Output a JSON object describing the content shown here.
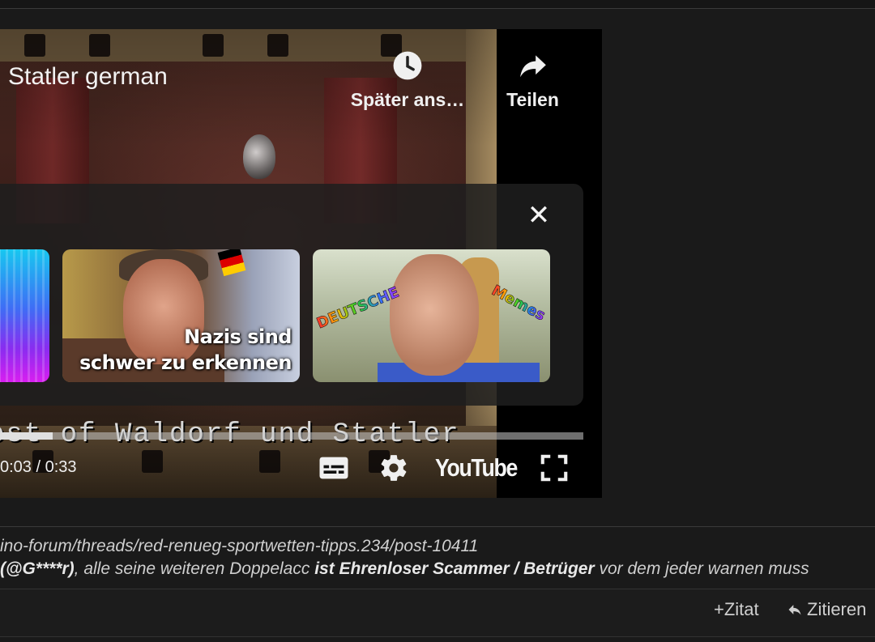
{
  "video": {
    "title": "Statler german",
    "watch_later_label": "Später ans…",
    "share_label": "Teilen",
    "close_symbol": "✕",
    "related": [
      {
        "caption": ""
      },
      {
        "caption_line1": "Nazis sind",
        "caption_line2": "schwer zu erkennen"
      },
      {
        "word_left": "DEUTSCHE",
        "word_right": "Memes"
      }
    ],
    "subtitle_overlay": "est of Waldorf und Statler",
    "progress": 0.09,
    "time_display": "0:03 / 0:33",
    "logo_text": "YouTube",
    "icons": {
      "watch_later": "clock-icon",
      "share": "share-arrow-icon",
      "close": "close-icon",
      "captions": "captions-icon",
      "settings": "gear-icon",
      "fullscreen": "fullscreen-icon"
    }
  },
  "post": {
    "link": "ino-forum/threads/red-renueg-sportwetten-tipps.234/post-10411",
    "text_part1": "(@G****r)",
    "text_part2": ", alle seine weiteren Doppelacc ",
    "text_part3": "ist Ehrenloser Scammer / Betrüger",
    "text_part4": " vor dem jeder warnen muss"
  },
  "actions": {
    "quote_add": "+Zitat",
    "reply": "Zitieren"
  }
}
